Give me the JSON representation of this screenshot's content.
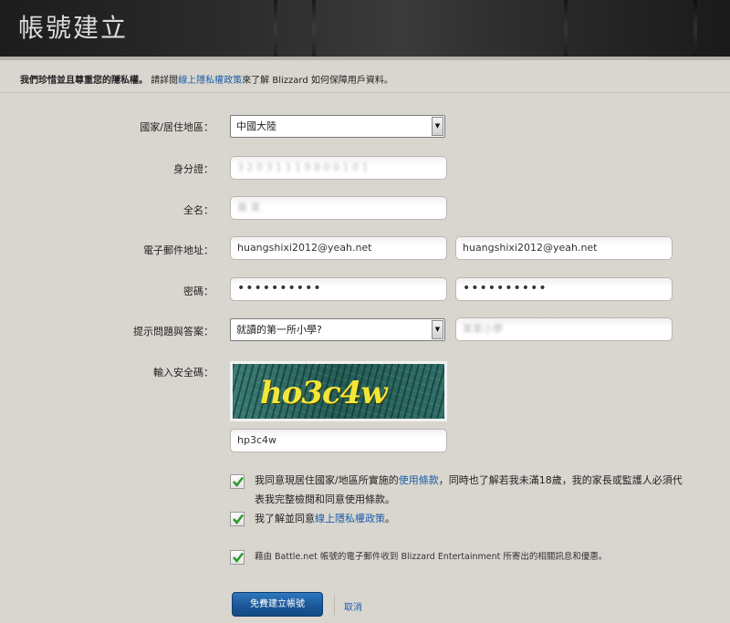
{
  "header": {
    "title": "帳號建立"
  },
  "privacy": {
    "bold_text": "我們珍惜並且尊重您的隱私權。",
    "text_before": "請詳閱",
    "link": "線上隱私權政策",
    "text_after": "來了解 Blizzard 如何保障用戶資料。"
  },
  "form": {
    "country": {
      "label": "國家/居住地區：",
      "value": "中國大陸"
    },
    "id_number": {
      "label": "身分證：",
      "value": "3 2 0 3 1 1 1 9 8 0 0 1 0 1"
    },
    "full_name": {
      "label": "全名：",
      "value": "黃 某"
    },
    "email": {
      "label": "電子郵件地址：",
      "value": "huangshixi2012@yeah.net",
      "confirm_value": "huangshixi2012@yeah.net"
    },
    "password": {
      "label": "密碼：",
      "value": "••••••••••",
      "confirm_value": "••••••••••"
    },
    "security_question": {
      "label": "提示問題與答案：",
      "value": "就讀的第一所小學?",
      "answer": "某某小學"
    },
    "captcha": {
      "label": "輸入安全碼：",
      "image_text": "ho3c4w",
      "value": "hp3c4w"
    }
  },
  "agreements": {
    "terms_before": "我同意現居住國家/地區所實施的",
    "terms_link": "使用條款",
    "terms_after": "，同時也了解若我未滿18歲，我的家長或監護人必須代表我完整檢閱和同意使用條款。",
    "privacy_before": "我了解並同意",
    "privacy_link": "線上隱私權政策",
    "privacy_after": "。",
    "marketing": "藉由 Battle.net 帳號的電子郵件收到 Blizzard Entertainment 所寄出的相關訊息和優惠。"
  },
  "actions": {
    "submit": "免費建立帳號",
    "cancel": "取消"
  },
  "colors": {
    "link": "#1a5ea8",
    "check": "#2f9a2f",
    "button": "#1a5799"
  }
}
